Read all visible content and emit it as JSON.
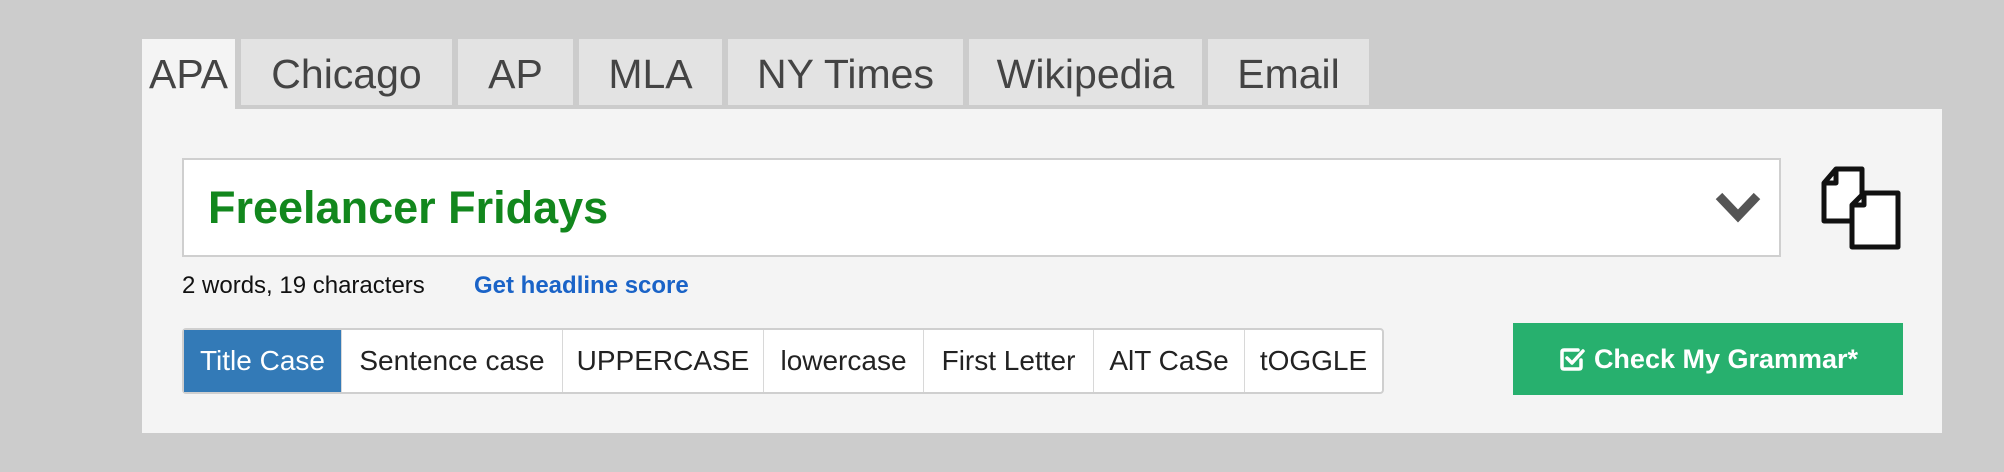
{
  "tabs": [
    {
      "label": "APA",
      "active": true
    },
    {
      "label": "Chicago",
      "active": false
    },
    {
      "label": "AP",
      "active": false
    },
    {
      "label": "MLA",
      "active": false
    },
    {
      "label": "NY Times",
      "active": false
    },
    {
      "label": "Wikipedia",
      "active": false
    },
    {
      "label": "Email",
      "active": false
    }
  ],
  "headline": {
    "value": "Freelancer Fridays",
    "text_color": "#12871d"
  },
  "stats": {
    "counts_text": "2 words, 19 characters",
    "score_link": "Get headline score"
  },
  "case_options": [
    {
      "label": "Title Case",
      "active": true
    },
    {
      "label": "Sentence case",
      "active": false
    },
    {
      "label": "UPPERCASE",
      "active": false
    },
    {
      "label": "lowercase",
      "active": false
    },
    {
      "label": "First Letter",
      "active": false
    },
    {
      "label": "AlT CaSe",
      "active": false
    },
    {
      "label": "tOGGLE",
      "active": false
    }
  ],
  "grammar_button": {
    "label": "Check My Grammar*",
    "icon": "check-square-icon",
    "color": "#27b06e"
  },
  "icons": {
    "dropdown": "chevron-down-icon",
    "copy": "copy-icon"
  },
  "colors": {
    "background": "#cccccc",
    "panel": "#f4f4f4",
    "active_case": "#337ab7",
    "link": "#1a63c7"
  }
}
